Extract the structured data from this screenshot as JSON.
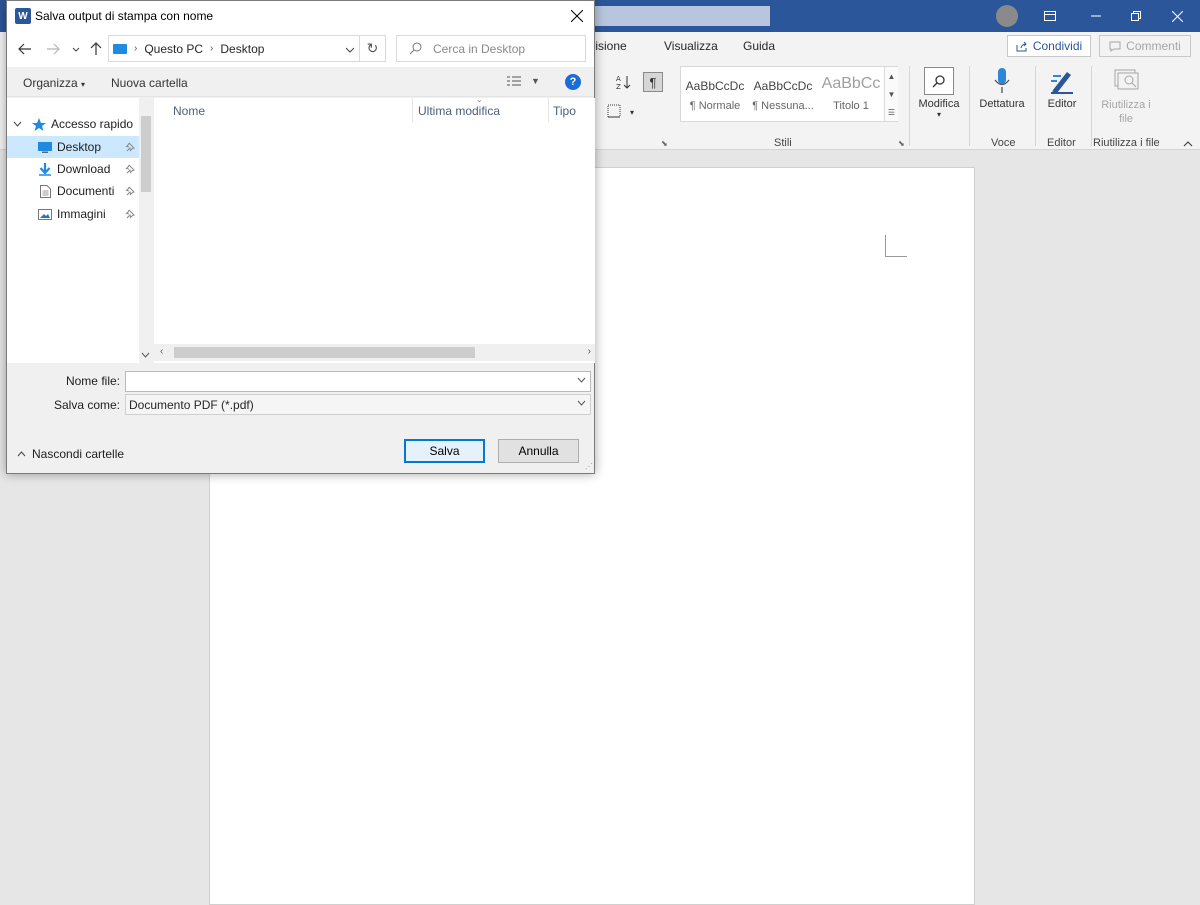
{
  "word": {
    "tabs": [
      "Revisione",
      "Visualizza",
      "Guida"
    ],
    "share_label": "Condividi",
    "comments_label": "Commenti",
    "styles": [
      {
        "sample": "AaBbCcDc",
        "name": "¶ Normale"
      },
      {
        "sample": "AaBbCcDc",
        "name": "¶ Nessuna..."
      },
      {
        "sample": "AaBbCc",
        "name": "Titolo 1"
      }
    ],
    "groups": {
      "stili": "Stili",
      "voce": "Voce",
      "editor": "Editor",
      "riutilizza": "Riutilizza i file"
    },
    "buttons": {
      "modifica": "Modifica",
      "dettatura": "Dettatura",
      "editor": "Editor",
      "riutilizza": "Riutilizza i file"
    },
    "accent": "#2b579a"
  },
  "dialog": {
    "title": "Salva output di stampa con nome",
    "app_icon": "W",
    "breadcrumb": [
      "Questo PC",
      "Desktop"
    ],
    "search_placeholder": "Cerca in Desktop",
    "commands": {
      "organize": "Organizza",
      "new_folder": "Nuova cartella",
      "help": "?"
    },
    "nav": [
      {
        "label": "Accesso rapido",
        "icon": "star-icon",
        "chevron": true,
        "selected": false,
        "pinned": false
      },
      {
        "label": "Desktop",
        "icon": "desktop-icon",
        "selected": true,
        "pinned": true
      },
      {
        "label": "Download",
        "icon": "download-icon",
        "selected": false,
        "pinned": true
      },
      {
        "label": "Documenti",
        "icon": "documents-icon",
        "selected": false,
        "pinned": true
      },
      {
        "label": "Immagini",
        "icon": "pictures-icon",
        "selected": false,
        "pinned": true
      }
    ],
    "columns": [
      "Nome",
      "Ultima modifica",
      "Tipo"
    ],
    "filename_label": "Nome file:",
    "filename_value": "",
    "savetype_label": "Salva come:",
    "savetype_value": "Documento PDF (*.pdf)",
    "hide_folders": "Nascondi cartelle",
    "save_button": "Salva",
    "cancel_button": "Annulla"
  }
}
